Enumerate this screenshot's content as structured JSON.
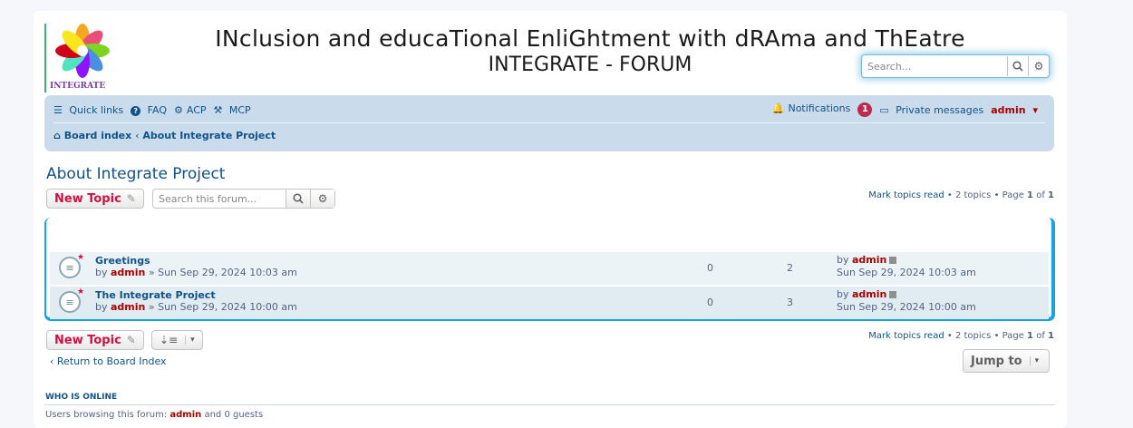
{
  "header": {
    "logo_text": "INTEGRATE",
    "title_line1": "INclusion and educaTional EnliGhtment with dRAma and ThEatre",
    "title_line2": "INTEGRATE - FORUM",
    "search_placeholder": "Search..."
  },
  "navbar": {
    "quick_links": "Quick links",
    "faq": "FAQ",
    "acp": "ACP",
    "mcp": "MCP",
    "notifications": "Notifications",
    "notifications_count": "1",
    "private_messages": "Private messages",
    "user": "admin",
    "breadcrumb_home": "Board index",
    "breadcrumb_current": "About Integrate Project"
  },
  "forum": {
    "title": "About Integrate Project",
    "new_topic": "New Topic",
    "search_placeholder": "Search this forum...",
    "pagination_top": {
      "mark_read": "Mark topics read",
      "topics": "2 topics",
      "page_label": "Page",
      "page": "1",
      "of": "of",
      "total": "1"
    },
    "topics": [
      {
        "title": "Greetings",
        "by": "by",
        "author": "admin",
        "date": "» Sun Sep 29, 2024 10:03 am",
        "replies": "0",
        "views": "2",
        "last_by": "by",
        "last_author": "admin",
        "last_date": "Sun Sep 29, 2024 10:03 am"
      },
      {
        "title": "The Integrate Project",
        "by": "by",
        "author": "admin",
        "date": "» Sun Sep 29, 2024 10:00 am",
        "replies": "0",
        "views": "3",
        "last_by": "by",
        "last_author": "admin",
        "last_date": "Sun Sep 29, 2024 10:00 am"
      }
    ],
    "return_link": "Return to Board Index",
    "jump_to": "Jump to"
  },
  "who_is_online": {
    "heading": "WHO IS ONLINE",
    "prefix": "Users browsing this forum:",
    "user": "admin",
    "suffix": "and 0 guests"
  },
  "colors": {
    "link": "#105289",
    "accent_red": "#d31141",
    "user_red": "#aa0000",
    "navbar_bg": "#cadceb",
    "forum_border": "#12a3eb",
    "badge": "#bc2a4d"
  },
  "icons": [
    "bars-icon",
    "question-icon",
    "gears-icon",
    "gavel-icon",
    "bell-icon",
    "inbox-icon",
    "caret-down-icon",
    "home-icon",
    "chevron-left-icon",
    "search-icon",
    "gear-icon",
    "pencil-icon",
    "topic-icon",
    "sort-icon",
    "external-link-icon"
  ]
}
